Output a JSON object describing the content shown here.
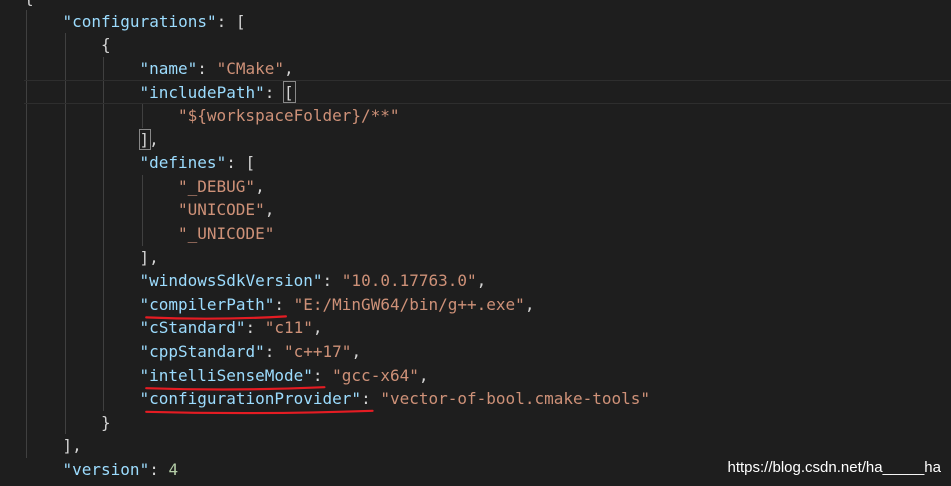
{
  "editor": {
    "language": "json",
    "theme_colors": {
      "background": "#1e1e1e",
      "key": "#9cdcfe",
      "string": "#ce9178",
      "number": "#b5cea8",
      "punctuation": "#d4d4d4",
      "annotation": "#e51c23"
    },
    "lines": [
      {
        "indent": 0,
        "tokens": [
          {
            "t": "p",
            "v": "{"
          }
        ]
      },
      {
        "indent": 1,
        "tokens": [
          {
            "t": "k",
            "v": "\"configurations\""
          },
          {
            "t": "p",
            "v": ": ["
          }
        ]
      },
      {
        "indent": 2,
        "tokens": [
          {
            "t": "p",
            "v": "{"
          }
        ]
      },
      {
        "indent": 3,
        "tokens": [
          {
            "t": "k",
            "v": "\"name\""
          },
          {
            "t": "p",
            "v": ": "
          },
          {
            "t": "s",
            "v": "\"CMake\""
          },
          {
            "t": "p",
            "v": ","
          }
        ]
      },
      {
        "indent": 3,
        "current": true,
        "tokens": [
          {
            "t": "k",
            "v": "\"includePath\""
          },
          {
            "t": "p",
            "v": ": "
          },
          {
            "t": "p",
            "v": "[",
            "box": true
          }
        ]
      },
      {
        "indent": 4,
        "tokens": [
          {
            "t": "s",
            "v": "\"${workspaceFolder}/**\""
          }
        ]
      },
      {
        "indent": 3,
        "tokens": [
          {
            "t": "p",
            "v": "]",
            "box": true
          },
          {
            "t": "p",
            "v": ","
          }
        ]
      },
      {
        "indent": 3,
        "tokens": [
          {
            "t": "k",
            "v": "\"defines\""
          },
          {
            "t": "p",
            "v": ": ["
          }
        ]
      },
      {
        "indent": 4,
        "tokens": [
          {
            "t": "s",
            "v": "\"_DEBUG\""
          },
          {
            "t": "p",
            "v": ","
          }
        ]
      },
      {
        "indent": 4,
        "tokens": [
          {
            "t": "s",
            "v": "\"UNICODE\""
          },
          {
            "t": "p",
            "v": ","
          }
        ]
      },
      {
        "indent": 4,
        "tokens": [
          {
            "t": "s",
            "v": "\"_UNICODE\""
          }
        ]
      },
      {
        "indent": 3,
        "tokens": [
          {
            "t": "p",
            "v": "],"
          }
        ]
      },
      {
        "indent": 3,
        "tokens": [
          {
            "t": "k",
            "v": "\"windowsSdkVersion\""
          },
          {
            "t": "p",
            "v": ": "
          },
          {
            "t": "s",
            "v": "\"10.0.17763.0\""
          },
          {
            "t": "p",
            "v": ","
          }
        ]
      },
      {
        "indent": 3,
        "underline": true,
        "tokens": [
          {
            "t": "k",
            "v": "\"compilerPath\""
          },
          {
            "t": "p",
            "v": ": "
          },
          {
            "t": "s",
            "v": "\"E:/MinGW64/bin/g++.exe\""
          },
          {
            "t": "p",
            "v": ","
          }
        ]
      },
      {
        "indent": 3,
        "tokens": [
          {
            "t": "k",
            "v": "\"cStandard\""
          },
          {
            "t": "p",
            "v": ": "
          },
          {
            "t": "s",
            "v": "\"c11\""
          },
          {
            "t": "p",
            "v": ","
          }
        ]
      },
      {
        "indent": 3,
        "tokens": [
          {
            "t": "k",
            "v": "\"cppStandard\""
          },
          {
            "t": "p",
            "v": ": "
          },
          {
            "t": "s",
            "v": "\"c++17\""
          },
          {
            "t": "p",
            "v": ","
          }
        ]
      },
      {
        "indent": 3,
        "underline": true,
        "tokens": [
          {
            "t": "k",
            "v": "\"intelliSenseMode\""
          },
          {
            "t": "p",
            "v": ": "
          },
          {
            "t": "s",
            "v": "\"gcc-x64\""
          },
          {
            "t": "p",
            "v": ","
          }
        ]
      },
      {
        "indent": 3,
        "underline": true,
        "tokens": [
          {
            "t": "k",
            "v": "\"configurationProvider\""
          },
          {
            "t": "p",
            "v": ": "
          },
          {
            "t": "s",
            "v": "\"vector-of-bool.cmake-tools\""
          }
        ]
      },
      {
        "indent": 2,
        "tokens": [
          {
            "t": "p",
            "v": "}"
          }
        ]
      },
      {
        "indent": 1,
        "tokens": [
          {
            "t": "p",
            "v": "],"
          }
        ]
      },
      {
        "indent": 1,
        "tokens": [
          {
            "t": "k",
            "v": "\"version\""
          },
          {
            "t": "p",
            "v": ": "
          },
          {
            "t": "n",
            "v": "4"
          }
        ]
      }
    ]
  },
  "watermark": "https://blog.csdn.net/ha_____ha"
}
